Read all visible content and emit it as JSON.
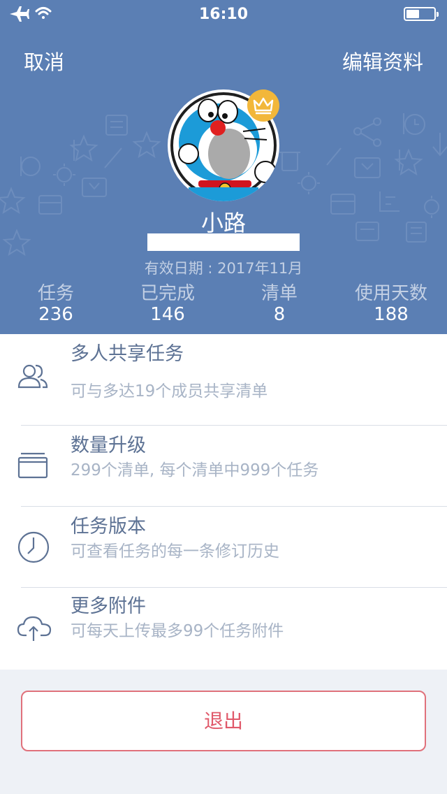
{
  "status_bar": {
    "time": "16:10",
    "icons": [
      "airplane-icon",
      "wifi-icon",
      "battery-icon"
    ]
  },
  "nav": {
    "cancel_label": "取消",
    "edit_label": "编辑资料"
  },
  "profile": {
    "username": "小路",
    "valid_date": "有效日期 : 2017年11月",
    "badge_icon": "crown-icon"
  },
  "stats": [
    {
      "label": "任务",
      "value": "236"
    },
    {
      "label": "已完成",
      "value": "146"
    },
    {
      "label": "清单",
      "value": "8"
    },
    {
      "label": "使用天数",
      "value": "188"
    }
  ],
  "features": [
    {
      "icon": "users-icon",
      "title": "多人共享任务",
      "subtitle": "可与多达19个成员共享清单"
    },
    {
      "icon": "folder-icon",
      "title": "数量升级",
      "subtitle": "299个清单, 每个清单中999个任务"
    },
    {
      "icon": "clock-icon",
      "title": "任务版本",
      "subtitle": "可查看任务的每一条修订历史"
    },
    {
      "icon": "cloud-upload-icon",
      "title": "更多附件",
      "subtitle": "可每天上传最多99个任务附件"
    }
  ],
  "logout_label": "退出",
  "colors": {
    "header_bg": "#5b7fb4",
    "accent_text": "#5d7294",
    "logout_red": "#e0596a",
    "crown_gold": "#f2b73a"
  }
}
